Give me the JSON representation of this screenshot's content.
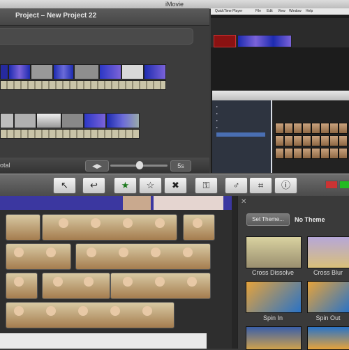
{
  "app": {
    "window_title": "iMovie"
  },
  "project": {
    "title": "Project – New Project 22",
    "footer_label": "otal",
    "zoom_value": "5s"
  },
  "quicktime": {
    "menu": [
      "QuickTime Player",
      "File",
      "Edit",
      "View",
      "Window",
      "Help"
    ]
  },
  "toolbar": {
    "buttons": [
      {
        "name": "select-tool-button",
        "glyph": "↖"
      },
      {
        "name": "add-to-project-button",
        "glyph": "↩"
      },
      {
        "name": "favorite-button",
        "glyph": "★"
      },
      {
        "name": "unmark-button",
        "glyph": "☆"
      },
      {
        "name": "reject-button",
        "glyph": "✖"
      },
      {
        "name": "keyword-button",
        "glyph": "⚿"
      },
      {
        "name": "voiceover-button",
        "glyph": "♂"
      },
      {
        "name": "crop-button",
        "glyph": "⌗"
      },
      {
        "name": "inspector-button",
        "glyph": "ⓘ"
      }
    ]
  },
  "theme_browser": {
    "set_theme_label": "Set Theme...",
    "current_theme": "No Theme",
    "transitions": [
      "Cross Dissolve",
      "Cross Blur",
      "Spin In",
      "Spin Out"
    ]
  },
  "colors": {
    "accent": "#3b37a0",
    "toolbar": "#5a5a5a",
    "panel": "#3a3a3a"
  }
}
